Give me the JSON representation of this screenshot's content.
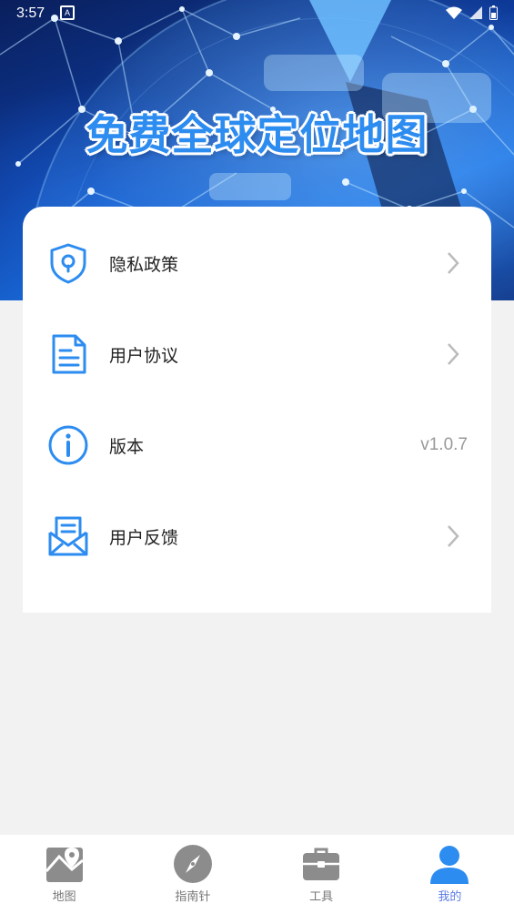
{
  "status_bar": {
    "time": "3:57",
    "notif_glyph": "A"
  },
  "banner": {
    "title": "免费全球定位地图"
  },
  "menu": {
    "items": [
      {
        "label": "隐私政策",
        "icon": "shield-lock-icon",
        "value": ""
      },
      {
        "label": "用户协议",
        "icon": "document-icon",
        "value": ""
      },
      {
        "label": "版本",
        "icon": "info-icon",
        "value": "v1.0.7"
      },
      {
        "label": "用户反馈",
        "icon": "mail-feedback-icon",
        "value": ""
      }
    ]
  },
  "bottom_nav": {
    "items": [
      {
        "label": "地图",
        "icon": "map-pin-icon"
      },
      {
        "label": "指南针",
        "icon": "compass-icon"
      },
      {
        "label": "工具",
        "icon": "toolbox-icon"
      },
      {
        "label": "我的",
        "icon": "person-icon",
        "active": true
      }
    ]
  },
  "colors": {
    "accent": "#2d8cf0",
    "nav_active": "#5b7be6",
    "nav_inactive": "#8c8c8c"
  }
}
